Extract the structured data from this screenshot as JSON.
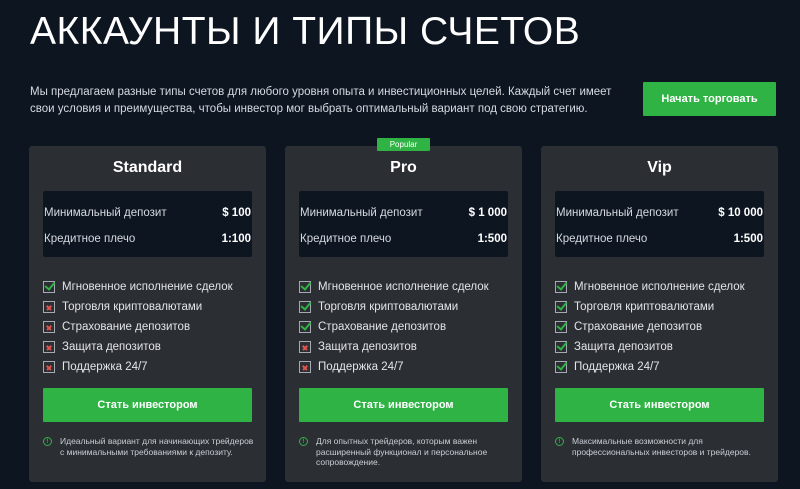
{
  "header": {
    "title": "АККАУНТЫ И ТИПЫ СЧЕТОВ",
    "intro": "Мы предлагаем разные типы счетов для любого уровня опыта и инвестиционных целей. Каждый счет имеет свои условия и преимущества, чтобы инвестор мог выбрать оптимальный вариант под свою стратегию.",
    "cta_label": "Начать торговать"
  },
  "popular_badge": "Popular",
  "stat_labels": {
    "min_deposit": "Минимальный депозит",
    "leverage": "Кредитное плечо"
  },
  "cards": [
    {
      "name": "Standard",
      "min_deposit": "$ 100",
      "leverage": "1:100",
      "features": [
        {
          "label": "Мгновенное исполнение сделок",
          "included": true
        },
        {
          "label": "Торговля криптовалютами",
          "included": false
        },
        {
          "label": "Страхование депозитов",
          "included": false
        },
        {
          "label": "Защита депозитов",
          "included": false
        },
        {
          "label": "Поддержка 24/7",
          "included": false
        }
      ],
      "button_label": "Стать инвестором",
      "note": "Идеальный вариант для начинающих трейдеров с минимальными требованиями к депозиту."
    },
    {
      "name": "Pro",
      "min_deposit": "$ 1 000",
      "leverage": "1:500",
      "features": [
        {
          "label": "Мгновенное исполнение сделок",
          "included": true
        },
        {
          "label": "Торговля криптовалютами",
          "included": true
        },
        {
          "label": "Страхование депозитов",
          "included": true
        },
        {
          "label": "Защита депозитов",
          "included": false
        },
        {
          "label": "Поддержка 24/7",
          "included": false
        }
      ],
      "button_label": "Стать инвестором",
      "note": "Для опытных трейдеров, которым важен расширенный функционал и персональное сопровождение."
    },
    {
      "name": "Vip",
      "min_deposit": "$ 10 000",
      "leverage": "1:500",
      "features": [
        {
          "label": "Мгновенное исполнение сделок",
          "included": true
        },
        {
          "label": "Торговля криптовалютами",
          "included": true
        },
        {
          "label": "Страхование депозитов",
          "included": true
        },
        {
          "label": "Защита депозитов",
          "included": true
        },
        {
          "label": "Поддержка 24/7",
          "included": true
        }
      ],
      "button_label": "Стать инвестором",
      "note": "Максимальные возможности для профессиональных инвесторов и трейдеров."
    }
  ],
  "colors": {
    "background": "#0d1521",
    "card": "#2b2e33",
    "accent": "#2fb344",
    "cross": "#e0554e"
  }
}
